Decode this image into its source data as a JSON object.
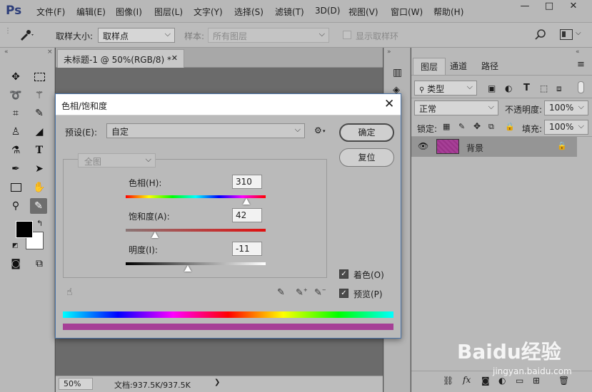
{
  "app": {
    "logo": "Ps"
  },
  "menu": [
    "文件(F)",
    "编辑(E)",
    "图像(I)",
    "图层(L)",
    "文字(Y)",
    "选择(S)",
    "滤镜(T)",
    "3D(D)",
    "视图(V)",
    "窗口(W)",
    "帮助(H)"
  ],
  "window_controls": {
    "minimize": "—",
    "maximize": "□",
    "close": "✕"
  },
  "options": {
    "sample_size_label": "取样大小:",
    "sample_size_value": "取样点",
    "sample_label": "样本:",
    "sample_value": "所有图层",
    "show_ring_label": "显示取样环"
  },
  "document": {
    "tab_title": "未标题-1 @ 50%(RGB/8) *",
    "tab_close": "✕",
    "zoom": "50%",
    "doc_info": "文档:937.5K/937.5K"
  },
  "layers_panel": {
    "tabs": [
      "图层",
      "通道",
      "路径"
    ],
    "filter_kind": "类型",
    "blend_mode": "正常",
    "opacity_label": "不透明度:",
    "opacity_value": "100%",
    "lock_label": "锁定:",
    "fill_label": "填充:",
    "fill_value": "100%",
    "layer_name": "背景"
  },
  "dialog": {
    "title": "色相/饱和度",
    "preset_label": "预设(E):",
    "preset_value": "自定",
    "channel_value": "全图",
    "ok": "确定",
    "reset": "复位",
    "hue_label": "色相(H):",
    "hue_value": "310",
    "hue_pos": 0.861,
    "sat_label": "饱和度(A):",
    "sat_value": "42",
    "sat_pos": 0.21,
    "light_label": "明度(I):",
    "light_value": "-11",
    "light_pos": 0.445,
    "colorize_label": "着色(O)",
    "preview_label": "预览(P)",
    "result_color": "#a63f96"
  },
  "watermark": {
    "brand": "Baidu经验",
    "url": "jingyan.baidu.com"
  }
}
